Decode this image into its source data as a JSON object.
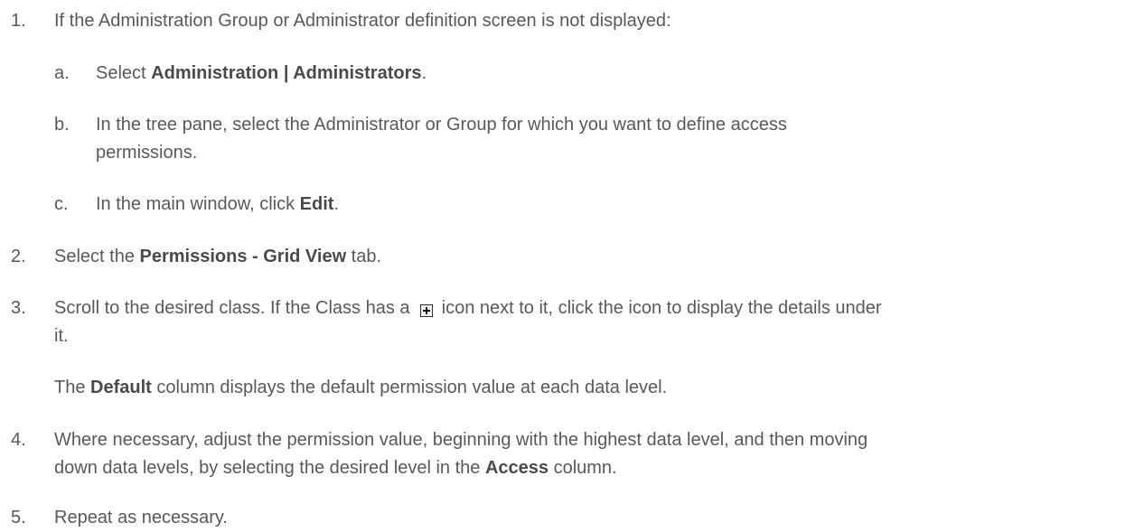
{
  "steps": {
    "s1": {
      "num": "1.",
      "text": "If the Administration Group or Administrator definition screen is not displayed:"
    },
    "s1a": {
      "letter": "a.",
      "pre": "Select ",
      "bold": "Administration | Administrators",
      "post": "."
    },
    "s1b": {
      "letter": "b.",
      "line1": "In the tree pane, select the Administrator or Group for which you want to define access",
      "line2": "permissions."
    },
    "s1c": {
      "letter": "c.",
      "pre": "In the main window, click ",
      "bold": "Edit",
      "post": "."
    },
    "s2": {
      "num": "2.",
      "pre": "Select the ",
      "bold": "Permissions - Grid View",
      "post": " tab."
    },
    "s3": {
      "num": "3.",
      "pre": "Scroll to the desired class. If the Class has a ",
      "icon": "expand-plus-icon",
      "post": " icon next to it, click the icon to display the details under",
      "line2": "it."
    },
    "s3note": {
      "pre": "The ",
      "bold": "Default",
      "post": " column displays the default permission value at each data level."
    },
    "s4": {
      "num": "4.",
      "line1": "Where necessary, adjust the permission value, beginning with the highest data level, and then moving",
      "line2_pre": "down data levels, by selecting the desired level in the ",
      "line2_bold": "Access",
      "line2_post": " column."
    },
    "s5": {
      "num": "5.",
      "text": "Repeat as necessary."
    }
  }
}
